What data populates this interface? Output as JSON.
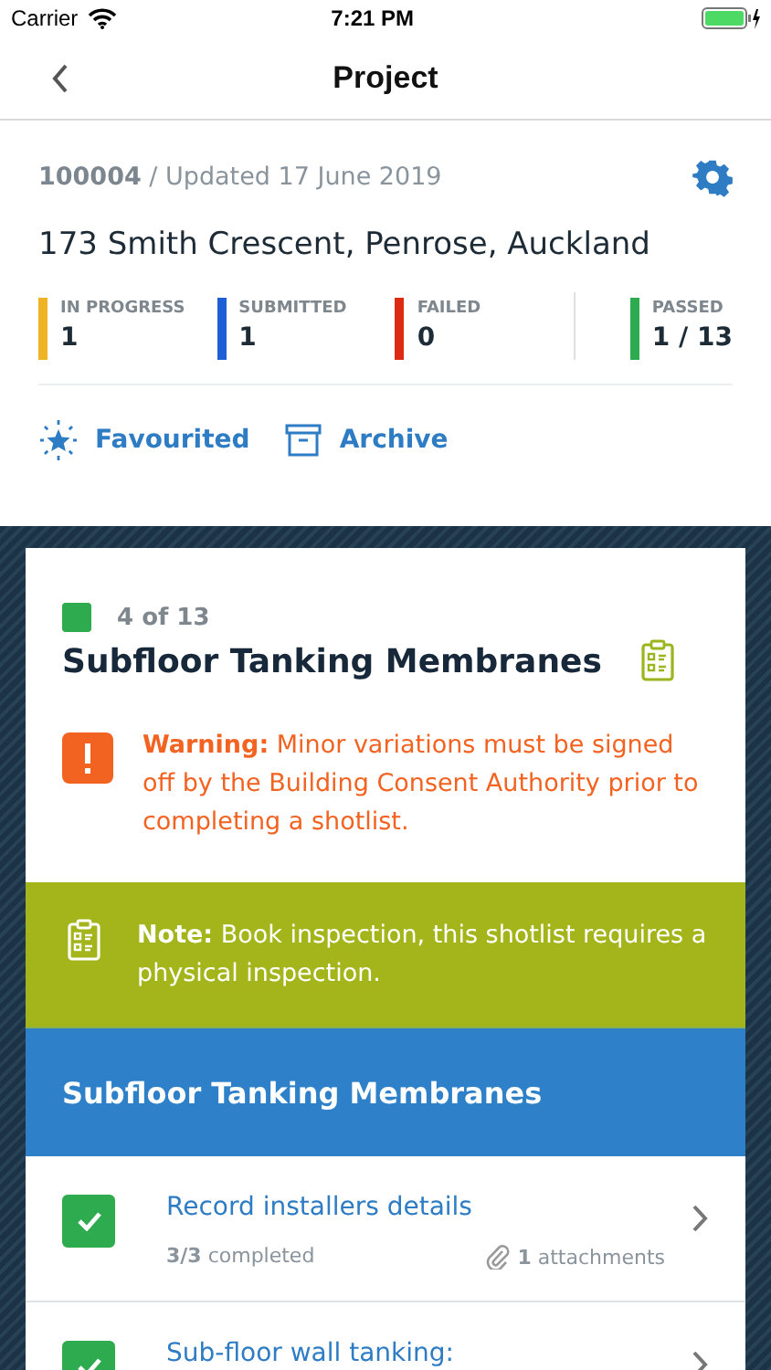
{
  "status_bar": {
    "carrier": "Carrier",
    "time": "7:21 PM"
  },
  "nav": {
    "title": "Project"
  },
  "project": {
    "meta": "**100004** / Updated 17 June 2019",
    "address": "173 Smith Crescent, Penrose, Auckland",
    "stats": [
      {
        "label": "IN PROGRESS",
        "value": "1",
        "color": "#f0b323"
      },
      {
        "label": "SUBMITTED",
        "value": "1",
        "color": "#1f5fd6"
      },
      {
        "label": "FAILED",
        "value": "0",
        "color": "#dd2a12"
      }
    ],
    "total": {
      "label": "PASSED",
      "value": "1 / 13",
      "color": "#2eaa4f"
    },
    "actions": [
      {
        "kind": "favourite",
        "label": "Favourited"
      },
      {
        "kind": "archive",
        "label": "Archive"
      }
    ]
  },
  "shotlist": {
    "position": "4 of 13",
    "color": "#2eaa4f",
    "title": "Subfloor Tanking Membranes",
    "warning": "**Warning:** Minor variations must be signed off by the Building Consent Authority prior to completing a shotlist.",
    "note": "**Note:** Book inspection, this shotlist requires a physical inspection.",
    "section_title": "Subfloor Tanking Membranes",
    "items": [
      {
        "title": "Record installers details",
        "checked": true,
        "progress": "**3/3** completed",
        "attachments": "**1** attachments"
      },
      {
        "title": "Sub-floor wall tanking:",
        "checked": true
      }
    ]
  }
}
